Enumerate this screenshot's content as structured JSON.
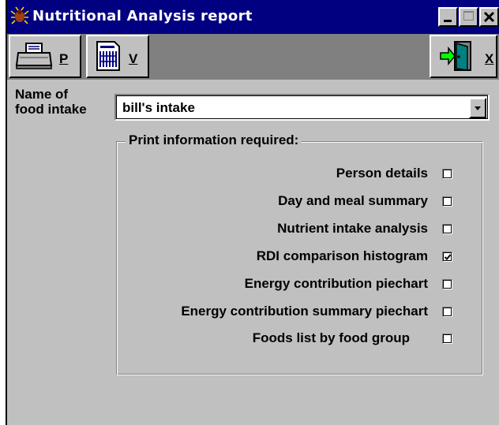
{
  "window": {
    "title": "Nutritional Analysis report"
  },
  "titlebar_buttons": {
    "minimize": "_",
    "maximize": "□",
    "close": "x"
  },
  "toolbar": {
    "print_key": "P",
    "view_key": "V",
    "exit_key": "X"
  },
  "form": {
    "food_intake_label_line1": "Name of",
    "food_intake_label_line2": "food intake",
    "food_intake_value": "bill's intake",
    "group_title": "Print information required:",
    "options": [
      {
        "label": "Person details",
        "checked": false
      },
      {
        "label": "Day and meal summary",
        "checked": false
      },
      {
        "label": "Nutrient intake analysis",
        "checked": false
      },
      {
        "label": "RDI comparison histogram",
        "checked": true
      },
      {
        "label": "Energy contribution piechart",
        "checked": false
      },
      {
        "label": "Energy contribution summary piechart",
        "checked": false
      },
      {
        "label": "Foods list by food group",
        "checked": false
      }
    ]
  },
  "colors": {
    "titlebar": "#000080",
    "face": "#c0c0c0",
    "toolbar_bg": "#808080",
    "exit_door": "#008080"
  },
  "icons": {
    "app": "bug-icon",
    "print": "printer-icon",
    "view": "document-icon",
    "exit": "exit-door-icon",
    "dropdown": "chevron-down-icon"
  }
}
